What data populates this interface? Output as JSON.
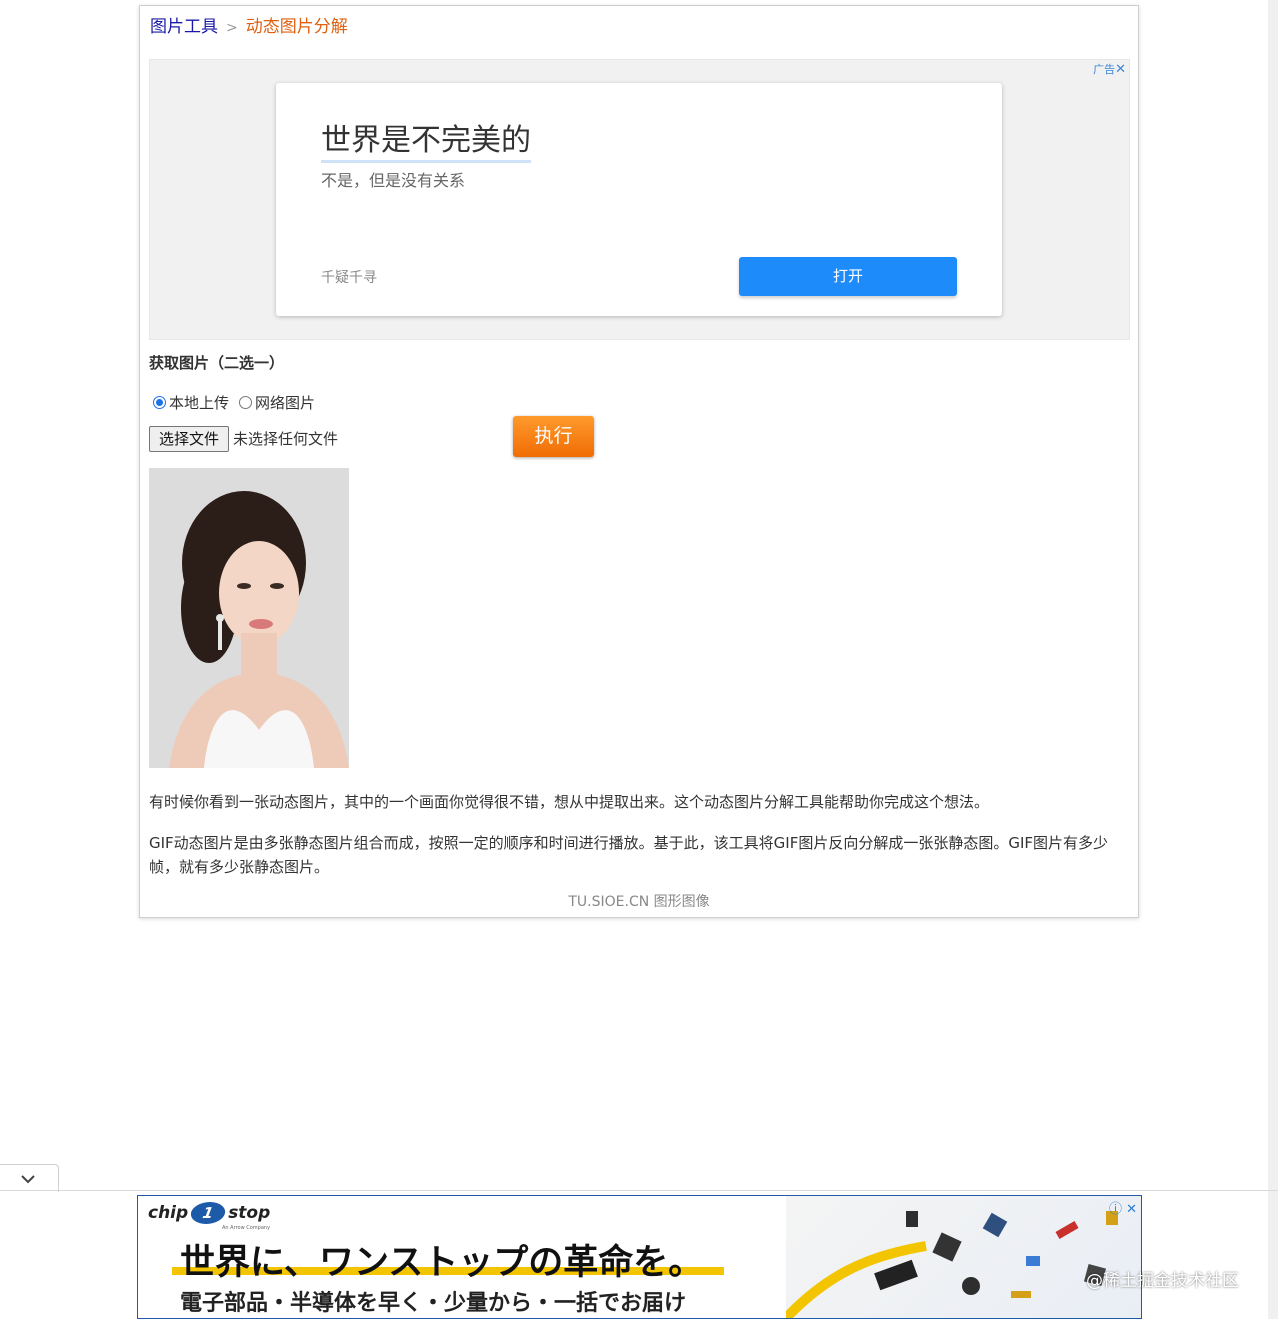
{
  "breadcrumb": {
    "root": "图片工具",
    "current": "动态图片分解"
  },
  "top_ad": {
    "tag": "广告",
    "title": "世界是不完美的",
    "subtitle": "不是，但是没有关系",
    "source": "千疑千寻",
    "button": "打开"
  },
  "form": {
    "section_title": "获取图片（二选一）",
    "options": [
      {
        "label": "本地上传",
        "checked": true
      },
      {
        "label": "网络图片",
        "checked": false
      }
    ],
    "file_button": "选择文件",
    "file_status": "未选择任何文件",
    "run_button": "执行"
  },
  "description": {
    "p1": "有时候你看到一张动态图片，其中的一个画面你觉得很不错，想从中提取出来。这个动态图片分解工具能帮助你完成这个想法。",
    "p2": "GIF动态图片是由多张静态图片组合而成，按照一定的顺序和时间进行播放。基于此，该工具将GIF图片反向分解成一张张静态图。GIF图片有多少帧，就有多少张静态图片。"
  },
  "footer": "TU.SIOE.CN 图形图像",
  "bottom_ad": {
    "logo_left": "chip",
    "logo_number": "1",
    "logo_right": "stop",
    "logo_sub": "An Arrow Company",
    "headline": "世界に、ワンストップの革命を。",
    "subline": "電子部品・半導体を早く・少量から・一括でお届け"
  },
  "watermark": "@稀土掘金技术社区",
  "colors": {
    "accent_orange": "#f06d04",
    "ad_button": "#1e8bfa",
    "link_blue": "#1a1aa6"
  }
}
